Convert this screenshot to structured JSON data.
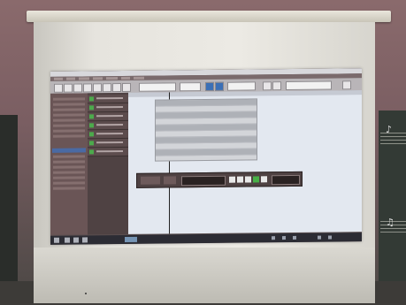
{
  "window": {
    "title": "",
    "menu_labels": []
  },
  "toolbar": {
    "position_readout": "",
    "tempo_readout": ""
  },
  "tracks": [
    {
      "name": ""
    },
    {
      "name": ""
    },
    {
      "name": ""
    },
    {
      "name": ""
    },
    {
      "name": ""
    },
    {
      "name": ""
    },
    {
      "name": ""
    }
  ],
  "transport": {
    "time_display": "",
    "bars_display": ""
  },
  "taskbar": {
    "clock": ""
  },
  "colors": {
    "accent_blue": "#3b6fb6",
    "track_enabled_green": "#4caa4c",
    "panel_dark": "#4f4243",
    "arrange_background": "#e3e8f0"
  },
  "icons": {
    "transport_play": "play-icon",
    "transport_record": "record-icon",
    "taskbar_start": "windows-start-icon"
  }
}
